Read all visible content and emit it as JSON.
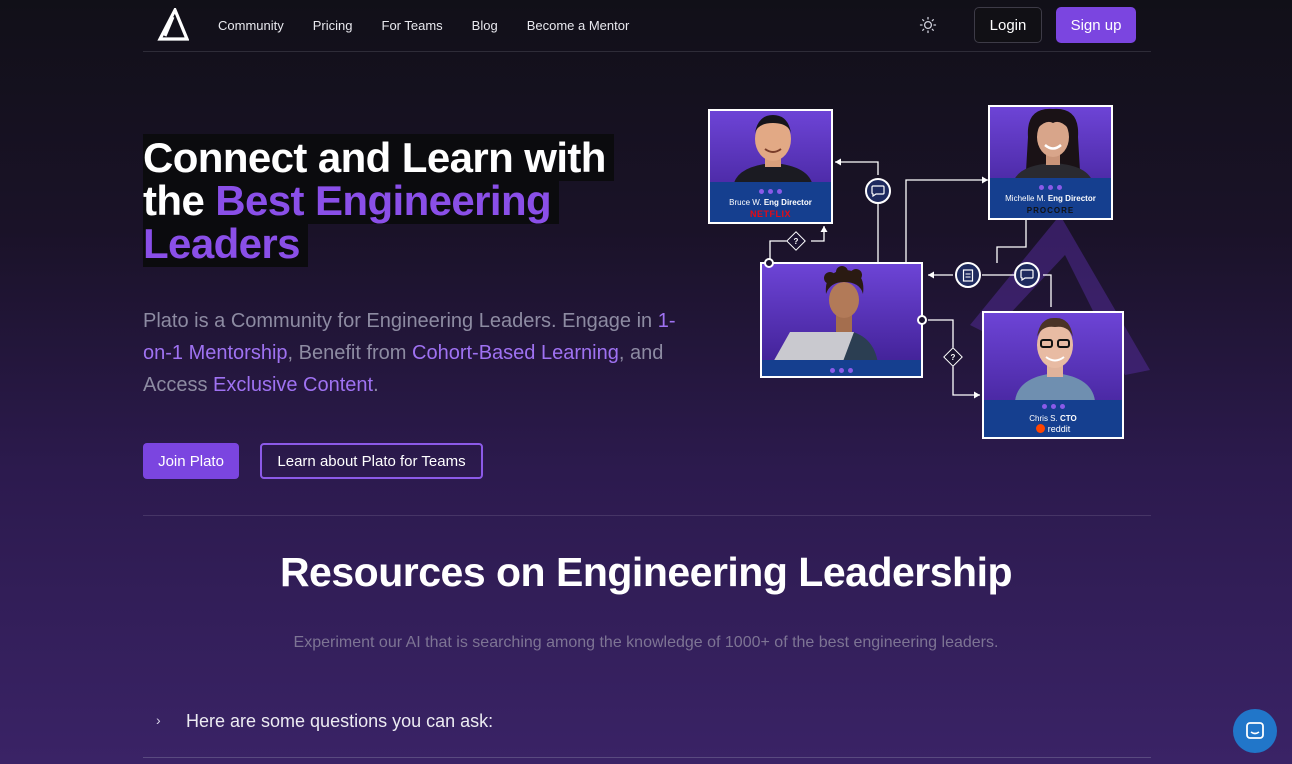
{
  "nav": {
    "links": [
      "Community",
      "Pricing",
      "For Teams",
      "Blog",
      "Become a Mentor"
    ],
    "login": "Login",
    "signup": "Sign up"
  },
  "hero": {
    "title_line1": "Connect and Learn with",
    "title_line2_a": "the ",
    "title_line2_b": "Best Engineering",
    "title_line3": "Leaders",
    "desc": {
      "p1": "Plato is a Community for Engineering Leaders. Engage in ",
      "a1": "1-on-1 Mentorship",
      "p2": ", Benefit from ",
      "a2": "Cohort-Based Learning",
      "p3": ", and Access ",
      "a3": "Exclusive Content",
      "p4": "."
    },
    "join_label": "Join Plato",
    "teams_label": "Learn about Plato for Teams"
  },
  "mentors": [
    {
      "name": "Bruce W.",
      "role": "Eng Director",
      "company": "NETFLIX"
    },
    {
      "name": "Michelle M.",
      "role": "Eng Director",
      "company": "PROCORE"
    },
    {
      "name": "Chris S.",
      "role": "CTO",
      "company": "reddit"
    }
  ],
  "resources": {
    "title": "Resources on Engineering Leadership",
    "subtitle": "Experiment our AI that is searching among the knowledge of 1000+ of the best engineering leaders.",
    "faq_label": "Here are some questions you can ask:"
  },
  "colors": {
    "accent": "#7b45e0",
    "netflix": "#e50914",
    "reddit": "#ff4500",
    "chat": "#2176c9"
  },
  "icons": [
    "logo-triangle-icon",
    "sun-icon",
    "chat-icon",
    "document-icon",
    "question-icon",
    "chevron-right-icon",
    "messenger-icon"
  ]
}
